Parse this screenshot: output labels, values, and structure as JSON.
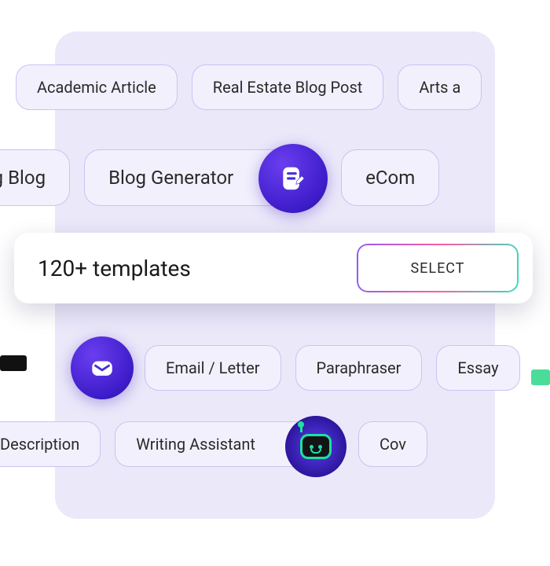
{
  "row1": {
    "academic": "Academic Article",
    "realestate": "Real Estate Blog Post",
    "arts": "Arts a"
  },
  "row2": {
    "marketing": "eting Blog",
    "blog_generator": "Blog Generator",
    "ecom": "eCom"
  },
  "card": {
    "title": "120+ templates",
    "select_label": "SELECT"
  },
  "row4": {
    "email": "Email / Letter",
    "paraphraser": "Paraphraser",
    "essay": "Essay"
  },
  "row5": {
    "product_desc": "uct Description",
    "writing_assistant": "Writing Assistant",
    "cover": "Cov"
  }
}
